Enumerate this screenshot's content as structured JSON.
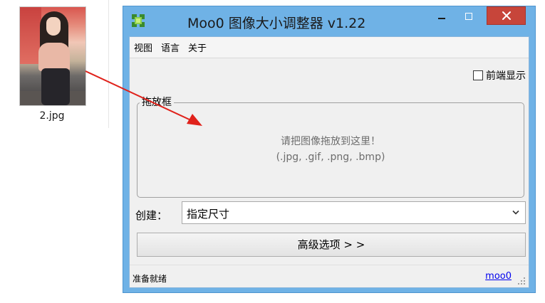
{
  "desktop": {
    "file_name": "2.jpg"
  },
  "window": {
    "title": "Moo0 图像大小调整器 v1.22",
    "minimize_glyph": "–",
    "maximize_glyph": "□",
    "close_glyph": "✕"
  },
  "menu": {
    "items": [
      {
        "label": "视图"
      },
      {
        "label": "语言"
      },
      {
        "label": "关于"
      }
    ]
  },
  "topmost_checkbox": {
    "label": "前端显示",
    "checked": false
  },
  "drop_area": {
    "legend": "拖放框",
    "hint_line1": "请把图像拖放到这里！",
    "hint_line2": "(.jpg, .gif, .png, .bmp)"
  },
  "create": {
    "label": "创建：",
    "selected": "指定尺寸"
  },
  "advanced_button": {
    "label": "高级选项 > >"
  },
  "status": {
    "text": "准备就绪",
    "link": "moo0"
  },
  "colors": {
    "window_frame": "#6fb2e6",
    "close_button": "#c7453a",
    "arrow": "#e0221b",
    "hint_text": "#6d6d6d"
  },
  "icons": [
    "app-icon",
    "minimize-icon",
    "maximize-icon",
    "close-icon",
    "chevron-down-icon",
    "resize-grip-icon",
    "checkbox-icon",
    "arrow-icon"
  ]
}
